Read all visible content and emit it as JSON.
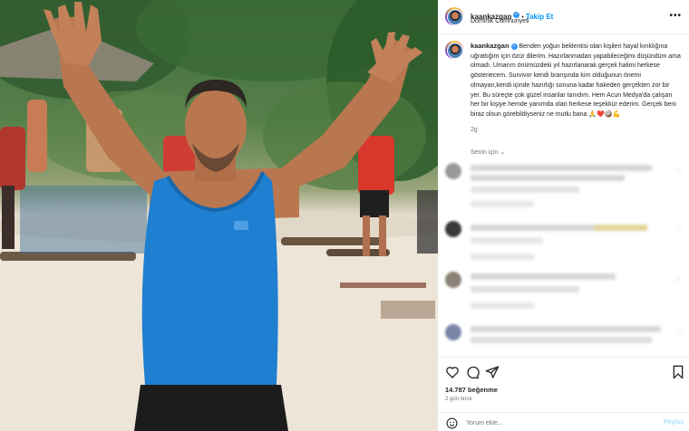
{
  "post": {
    "author": "kaankazgan",
    "follow_label": "Takip Et",
    "separator": "•",
    "location": "Dominik Cumhuriyeti",
    "more_label": "•••",
    "caption": "Benden yoğun beklentisi olan kişileri hayal kırıklığına uğrattığım için özür dilerim. Hazırlanmadan yapabileceğimi düşündüm ama olmadı. Umarım önümüzdeki yıl hazırlanarak gerçek halimi herkese gösteriecem. Survivor kendi branşında kim olduğunun önemi olmayan,kendi içinde hazırlığı sonuna kadar hakeden gerçekten zor bir yer. Bu süreçte çok güzel insanlar tanıdım. Hem Acun Medya'da çalışan her bir kişiye hemde yanımda olan herkese teşekkür ederim. Gerçek beni biraz olsun görebildiyseniz ne mutlu bana 🙏❤️🥥💪",
    "caption_age": "2g"
  },
  "comments": {
    "sort_label": "Senin için ⌄",
    "count_blurred": 4
  },
  "actions": {
    "likes": "14.787 beğenme",
    "time_ago": "2 gün önce",
    "comment_placeholder": "Yorum ekle...",
    "post_label": "Paylaş"
  },
  "colors": {
    "accent": "#0095f6",
    "verified": "#3897f0",
    "tank_top": "#1f7fd0",
    "sand": "#ece5d8"
  },
  "icons": [
    "heart-icon",
    "comment-icon",
    "share-icon",
    "bookmark-icon",
    "emoji-icon",
    "verified-icon",
    "more-icon"
  ]
}
